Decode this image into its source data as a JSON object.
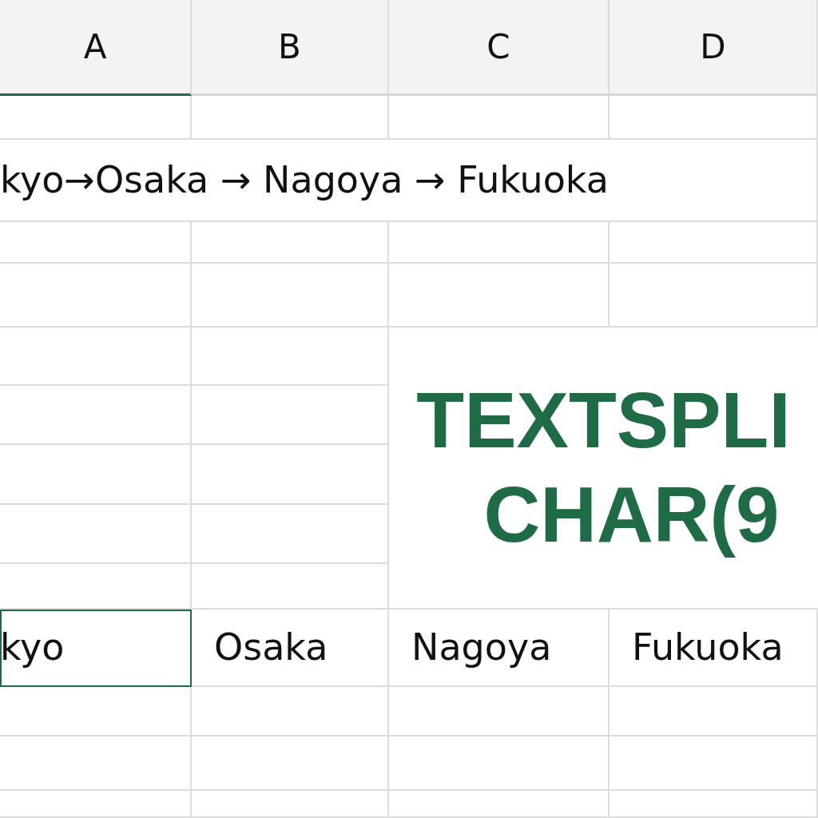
{
  "column_headers": [
    {
      "label": "A",
      "selected": true
    },
    {
      "label": "B",
      "selected": false
    },
    {
      "label": "C",
      "selected": false
    },
    {
      "label": "D",
      "selected": false
    }
  ],
  "input_cell": {
    "text": "kyo→Osaka → Nagoya → Fukuoka"
  },
  "overlay_title": {
    "lines": [
      "TEXTSPLI",
      "CHAR(9"
    ]
  },
  "result_cells": [
    {
      "text": "kyo",
      "selected": true
    },
    {
      "text": "Osaka",
      "selected": false
    },
    {
      "text": "Nagoya",
      "selected": false
    },
    {
      "text": "Fukuoka",
      "selected": false
    }
  ]
}
